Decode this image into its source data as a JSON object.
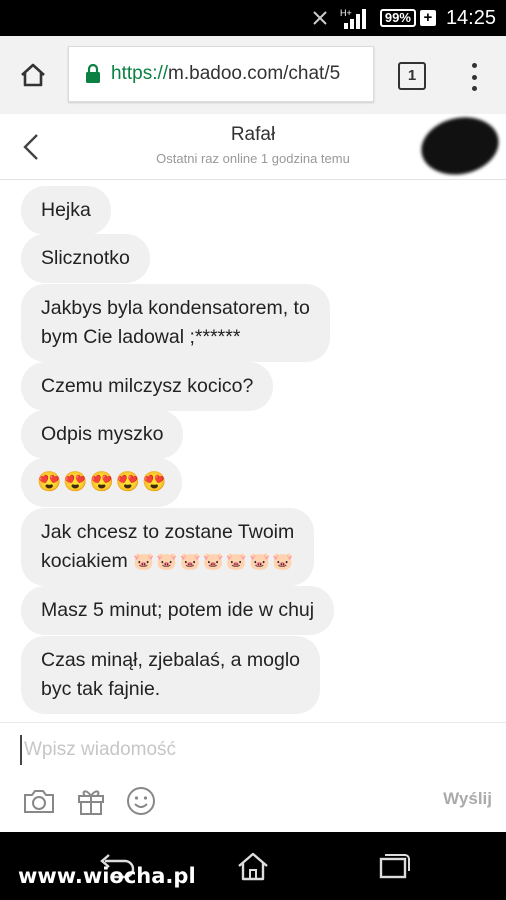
{
  "status_bar": {
    "time": "14:25",
    "battery_percent": "99%",
    "network_label": "H+",
    "icons": [
      "bluetooth-off-icon",
      "signal-icon",
      "battery-icon",
      "charging-plus-icon"
    ]
  },
  "browser": {
    "url_scheme": "https://",
    "url_rest": "m.badoo.com/chat/5",
    "tabs_count": "1",
    "icons": [
      "home-icon",
      "lock-icon",
      "tabs-icon",
      "overflow-menu-icon"
    ]
  },
  "chat_header": {
    "name": "Rafał",
    "status": "Ostatni raz online 1 godzina temu"
  },
  "messages": [
    {
      "text": "Hejka"
    },
    {
      "text": "Slicznotko"
    },
    {
      "line1": "Jakbys byla kondensatorem, to",
      "line2": "bym Cie ladowal ;******"
    },
    {
      "text": "Czemu milczysz kocico?"
    },
    {
      "text": "Odpis myszko"
    },
    {
      "emoji": [
        "😍",
        "😍",
        "😍",
        "😍",
        "😍"
      ]
    },
    {
      "line1": "Jak chcesz to zostane Twoim",
      "line2": "kociakiem",
      "emoji": [
        "🐷",
        "🐷",
        "🐷",
        "🐷",
        "🐷",
        "🐷",
        "🐷"
      ]
    },
    {
      "text": "Masz 5 minut; potem ide w chuj"
    },
    {
      "line1": "Czas minął, zjebalaś, a moglo",
      "line2": "byc tak fajnie."
    }
  ],
  "composer": {
    "placeholder": "Wpisz wiadomość",
    "send_label": "Wyślij",
    "tools": [
      "camera-icon",
      "gift-icon",
      "smiley-icon"
    ]
  },
  "nav": {
    "items": [
      "back-nav-icon",
      "home-nav-icon",
      "recents-nav-icon"
    ],
    "watermark": "www.wiocha.pl"
  },
  "colors": {
    "bubble": "#f0f0f0",
    "https_green": "#0b8043",
    "muted": "#999999"
  }
}
